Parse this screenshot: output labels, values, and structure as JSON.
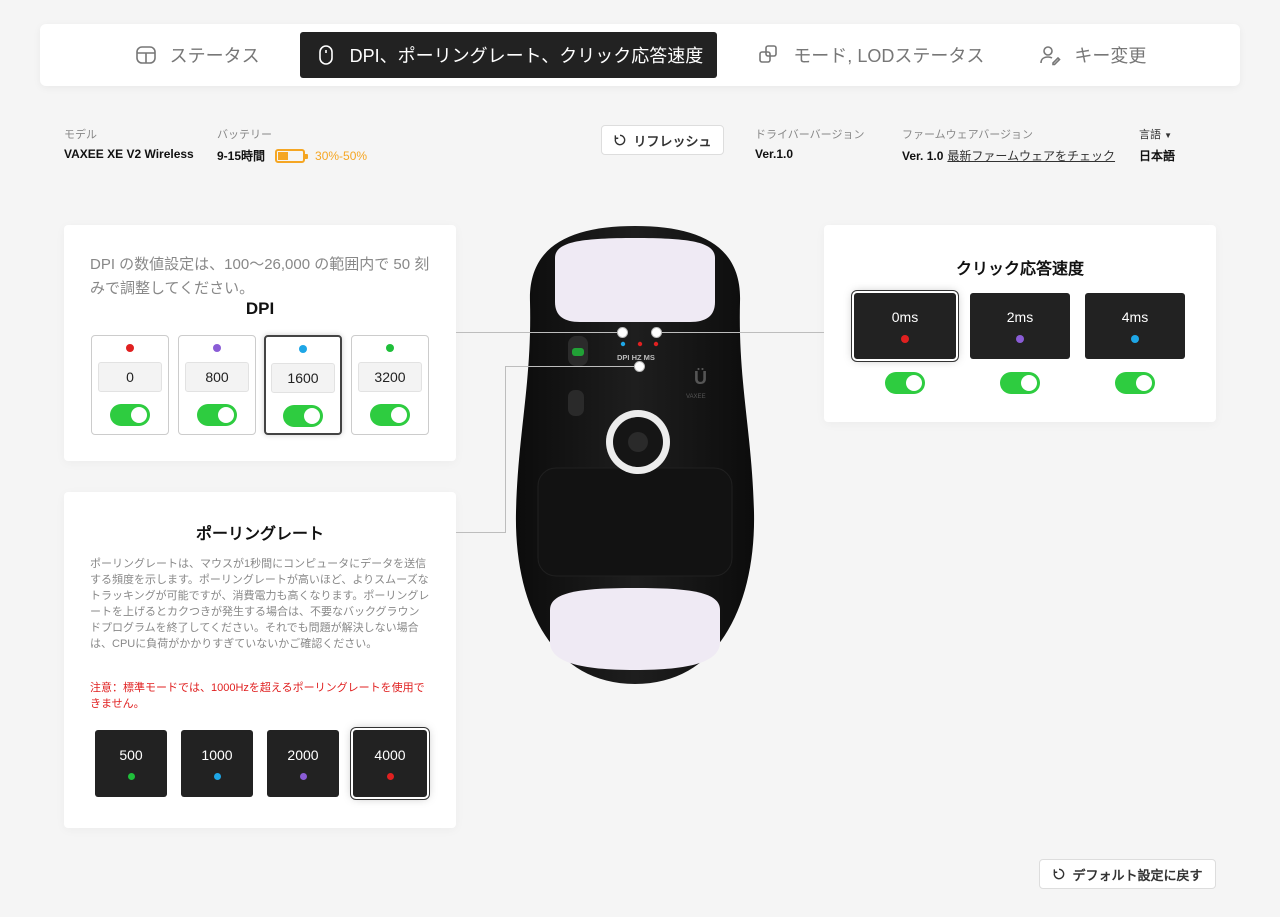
{
  "nav": {
    "tabs": [
      {
        "label": "ステータス",
        "icon": "status-icon",
        "active": false
      },
      {
        "label": "DPI、ポーリングレート、クリック応答速度",
        "icon": "mouse-icon",
        "active": true
      },
      {
        "label": "モード, LODステータス",
        "icon": "mode-icon",
        "active": false
      },
      {
        "label": "キー変更",
        "icon": "user-edit-icon",
        "active": false
      }
    ]
  },
  "info": {
    "model_label": "モデル",
    "model_value": "VAXEE XE V2 Wireless",
    "battery_label": "バッテリー",
    "battery_hours": "9-15時間",
    "battery_range": "30%-50%",
    "battery_level": 0.4,
    "refresh_label": "リフレッシュ",
    "driver_label": "ドライバーバージョン",
    "driver_value": "Ver.1.0",
    "firmware_label": "ファームウェアバージョン",
    "firmware_value": "Ver. 1.0",
    "firmware_link": "最新ファームウェアをチェック",
    "language_label": "言語",
    "language_value": "日本語"
  },
  "dpi": {
    "description": "DPI の数値設定は、100～26,000 の範囲内で 50 刻みで調整してください。",
    "title": "DPI",
    "slots": [
      {
        "value": "0",
        "color": "#e02020",
        "enabled": true,
        "selected": false
      },
      {
        "value": "800",
        "color": "#8a5cd6",
        "enabled": true,
        "selected": false
      },
      {
        "value": "1600",
        "color": "#1ea6e6",
        "enabled": true,
        "selected": true
      },
      {
        "value": "3200",
        "color": "#1fbf3a",
        "enabled": true,
        "selected": false
      }
    ]
  },
  "click_response": {
    "title": "クリック応答速度",
    "options": [
      {
        "label": "0ms",
        "color": "#e02020",
        "enabled": true,
        "selected": true
      },
      {
        "label": "2ms",
        "color": "#8a5cd6",
        "enabled": true,
        "selected": false
      },
      {
        "label": "4ms",
        "color": "#1ea6e6",
        "enabled": true,
        "selected": false
      }
    ]
  },
  "polling": {
    "title": "ポーリングレート",
    "description": "ポーリングレートは、マウスが1秒間にコンピュータにデータを送信する頻度を示します。ポーリングレートが高いほど、よりスムーズなトラッキングが可能ですが、消費電力も高くなります。ポーリングレートを上げるとカクつきが発生する場合は、不要なバックグラウンドプログラムを終了してください。それでも問題が解決しない場合は、CPUに負荷がかかりすぎていないかご確認ください。",
    "warning": "注意：標準モードでは、1000Hzを超えるポーリングレートを使用できません。",
    "options": [
      {
        "label": "500",
        "color": "#1fbf3a",
        "selected": false
      },
      {
        "label": "1000",
        "color": "#1ea6e6",
        "selected": false
      },
      {
        "label": "2000",
        "color": "#8a5cd6",
        "selected": false
      },
      {
        "label": "4000",
        "color": "#e02020",
        "selected": true
      }
    ]
  },
  "mouse": {
    "indicator_labels": "DPI HZ MS",
    "brand": "VAXEE"
  },
  "reset_label": "デフォルト設定に戻す"
}
